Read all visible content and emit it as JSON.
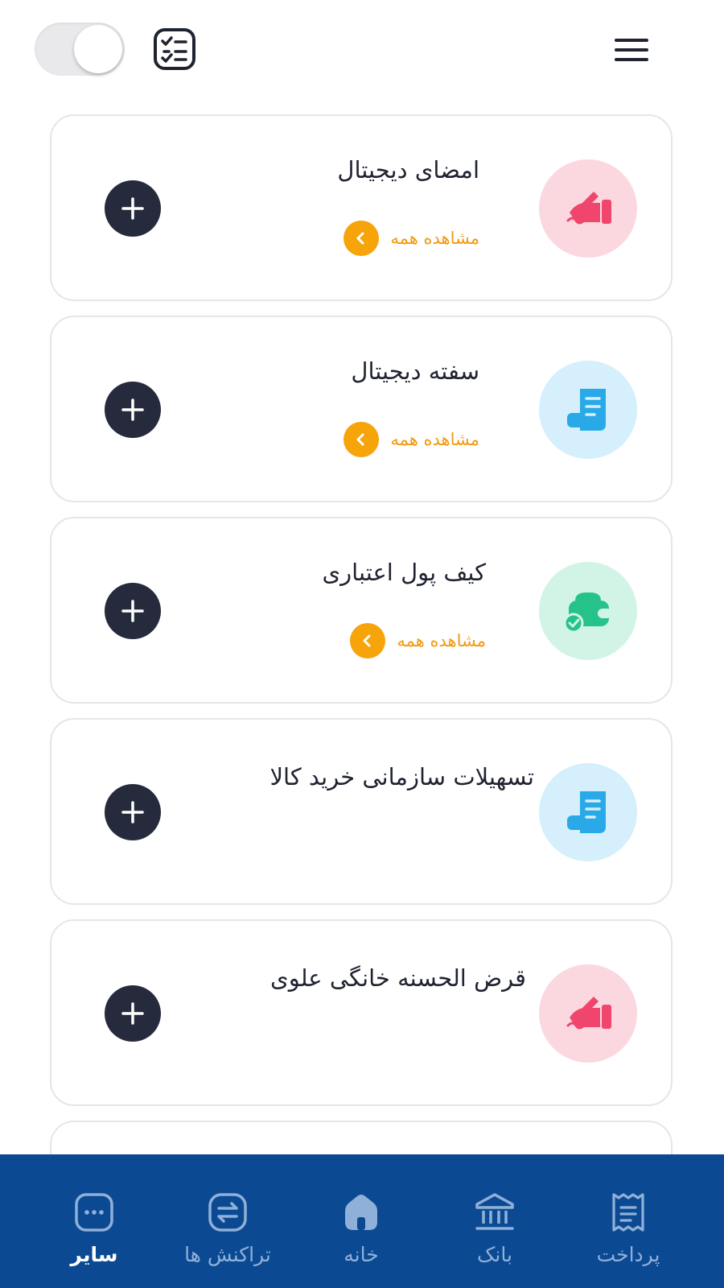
{
  "header": {
    "toggle_state": "off",
    "task_icon": "checklist-icon",
    "menu_icon": "hamburger-menu-icon"
  },
  "colors": {
    "accent_orange": "#f7a40b",
    "dark_button": "#262a3d",
    "nav_background": "#0b4a93",
    "pink_circle": "#fbd8e0",
    "blue_circle": "#d5effc",
    "green_circle": "#d2f4e6"
  },
  "cards": [
    {
      "title": "امضای دیجیتال",
      "view_all": "مشاهده همه",
      "icon": "hand-signature-icon",
      "color": "pink"
    },
    {
      "title": "سفته دیجیتال",
      "view_all": "مشاهده همه",
      "icon": "scroll-document-icon",
      "color": "blue"
    },
    {
      "title": "کیف پول اعتباری",
      "view_all": "مشاهده همه",
      "icon": "wallet-check-icon",
      "color": "green"
    },
    {
      "title": "تسهیلات سازمانی خرید کالا",
      "icon": "scroll-document-icon",
      "color": "blue"
    },
    {
      "title": "قرض الحسنه خانگی علوی",
      "icon": "hand-signature-icon",
      "color": "pink"
    }
  ],
  "bottom_nav": [
    {
      "label": "سایر",
      "icon": "more-dots-icon",
      "active": true
    },
    {
      "label": "تراکنش ها",
      "icon": "transactions-icon",
      "active": false
    },
    {
      "label": "خانه",
      "icon": "home-icon",
      "active": false
    },
    {
      "label": "بانک",
      "icon": "bank-icon",
      "active": false
    },
    {
      "label": "پرداخت",
      "icon": "receipt-icon",
      "active": false
    }
  ]
}
